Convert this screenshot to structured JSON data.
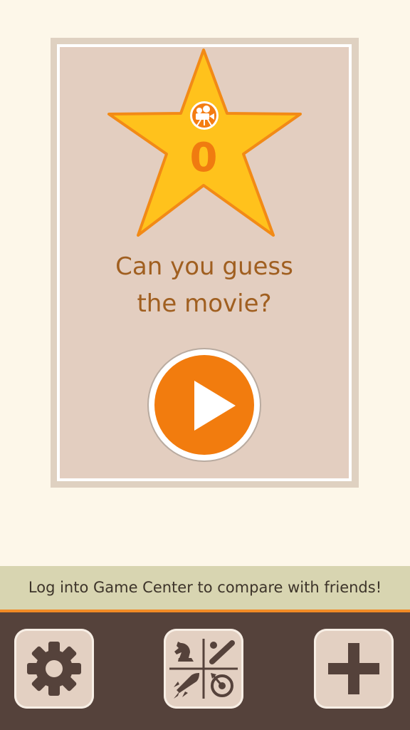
{
  "game": {
    "score": "0",
    "headline_line1": "Can you guess",
    "headline_line2": "the movie?"
  },
  "banner": {
    "text": "Log into Game Center to compare with friends!"
  },
  "toolbar": {
    "buttons": [
      {
        "icon": "gear-icon"
      },
      {
        "icon": "categories-icon"
      },
      {
        "icon": "plus-icon"
      }
    ]
  },
  "colors": {
    "background": "#fdf7e9",
    "card": "#e3cec0",
    "star": "#ffc21c",
    "accent": "#f27c0e",
    "headline": "#a05f20",
    "toolbar": "#55423b",
    "banner": "#d8d5b1"
  }
}
